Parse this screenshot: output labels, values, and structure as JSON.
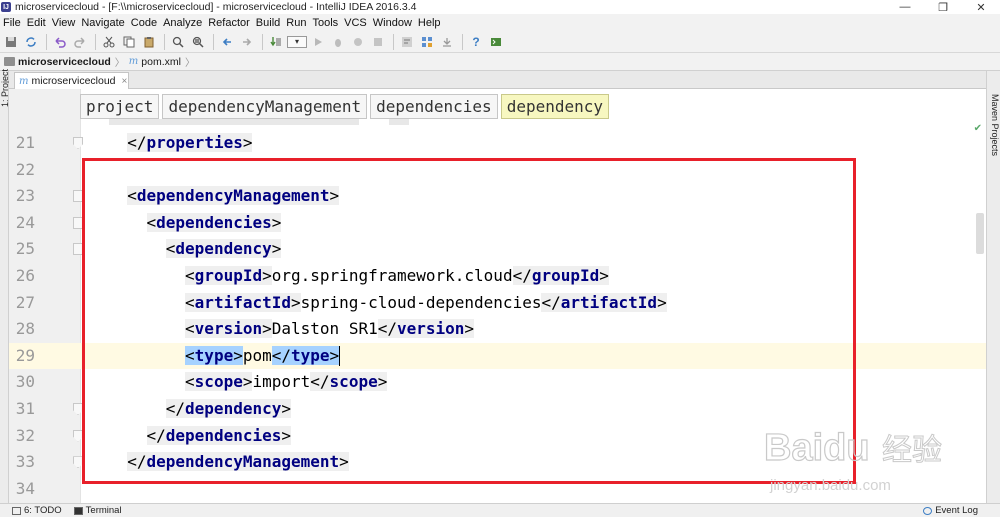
{
  "window": {
    "title": "microservicecloud - [F:\\\\microservicecloud] - microservicecloud - IntelliJ IDEA 2016.3.4",
    "controls": {
      "minimize": "—",
      "restore": "❐",
      "close": "✕"
    }
  },
  "menu": [
    "File",
    "Edit",
    "View",
    "Navigate",
    "Code",
    "Analyze",
    "Refactor",
    "Build",
    "Run",
    "Tools",
    "VCS",
    "Window",
    "Help"
  ],
  "toolbar": {
    "icons": [
      "save-icon",
      "sync-icon",
      "undo-icon",
      "redo-icon",
      "cut-icon",
      "copy-icon",
      "paste-icon",
      "find-icon",
      "replace-icon",
      "back-icon",
      "forward-icon",
      "build-icon",
      "run-config-combo",
      "run-icon",
      "debug-icon",
      "coverage-icon",
      "stop-icon",
      "vcs-icon",
      "project-structure-icon",
      "sdk-icon",
      "help-icon",
      "terminal-icon"
    ],
    "combo_label": "▾"
  },
  "breadcrumb": {
    "project": "microservicecloud",
    "file": "pom.xml"
  },
  "side": {
    "left_tool": "1: Project",
    "right_tool": "Maven Projects"
  },
  "tabs": [
    {
      "label": "microservicecloud",
      "close": "×"
    }
  ],
  "editor": {
    "tag_path": [
      "project",
      "dependencyManagement",
      "dependencies",
      "dependency"
    ],
    "lines": [
      {
        "num": "21",
        "indent": 2,
        "parts": [
          [
            "tag",
            "</properties>"
          ]
        ]
      },
      {
        "num": "22",
        "indent": 0,
        "parts": []
      },
      {
        "num": "23",
        "indent": 2,
        "parts": [
          [
            "tag",
            "<dependencyManagement>"
          ]
        ]
      },
      {
        "num": "24",
        "indent": 4,
        "parts": [
          [
            "tag",
            "<dependencies>"
          ]
        ]
      },
      {
        "num": "25",
        "indent": 6,
        "parts": [
          [
            "tag",
            "<dependency>"
          ]
        ]
      },
      {
        "num": "26",
        "indent": 8,
        "parts": [
          [
            "tag",
            "<groupId>"
          ],
          [
            "text",
            "org.springframework.cloud"
          ],
          [
            "tag",
            "</groupId>"
          ]
        ]
      },
      {
        "num": "27",
        "indent": 8,
        "parts": [
          [
            "tag",
            "<artifactId>"
          ],
          [
            "text",
            "spring-cloud-dependencies"
          ],
          [
            "tag",
            "</artifactId>"
          ]
        ]
      },
      {
        "num": "28",
        "indent": 8,
        "parts": [
          [
            "tag",
            "<version>"
          ],
          [
            "text",
            "Dalston SR1"
          ],
          [
            "tag",
            "</version>"
          ]
        ]
      },
      {
        "num": "29",
        "indent": 8,
        "parts": [
          [
            "hltag",
            "<type>"
          ],
          [
            "text",
            "pom"
          ],
          [
            "hltag",
            "</type>"
          ],
          [
            "caret",
            ""
          ]
        ],
        "current": true
      },
      {
        "num": "30",
        "indent": 8,
        "parts": [
          [
            "tag",
            "<scope>"
          ],
          [
            "text",
            "import"
          ],
          [
            "tag",
            "</scope>"
          ]
        ]
      },
      {
        "num": "31",
        "indent": 6,
        "parts": [
          [
            "tag",
            "</dependency>"
          ]
        ]
      },
      {
        "num": "32",
        "indent": 4,
        "parts": [
          [
            "tag",
            "</dependencies>"
          ]
        ]
      },
      {
        "num": "33",
        "indent": 2,
        "parts": [
          [
            "tag",
            "</dependencyManagement>"
          ]
        ]
      },
      {
        "num": "34",
        "indent": 0,
        "parts": []
      }
    ],
    "highlight_color": "#e8202a"
  },
  "status": {
    "todo": "6: TODO",
    "terminal": "Terminal",
    "event_log": "Event Log"
  },
  "watermark": {
    "brand": "Baidu",
    "brand_cn": "经验",
    "url": "jingyan.baidu.com"
  }
}
